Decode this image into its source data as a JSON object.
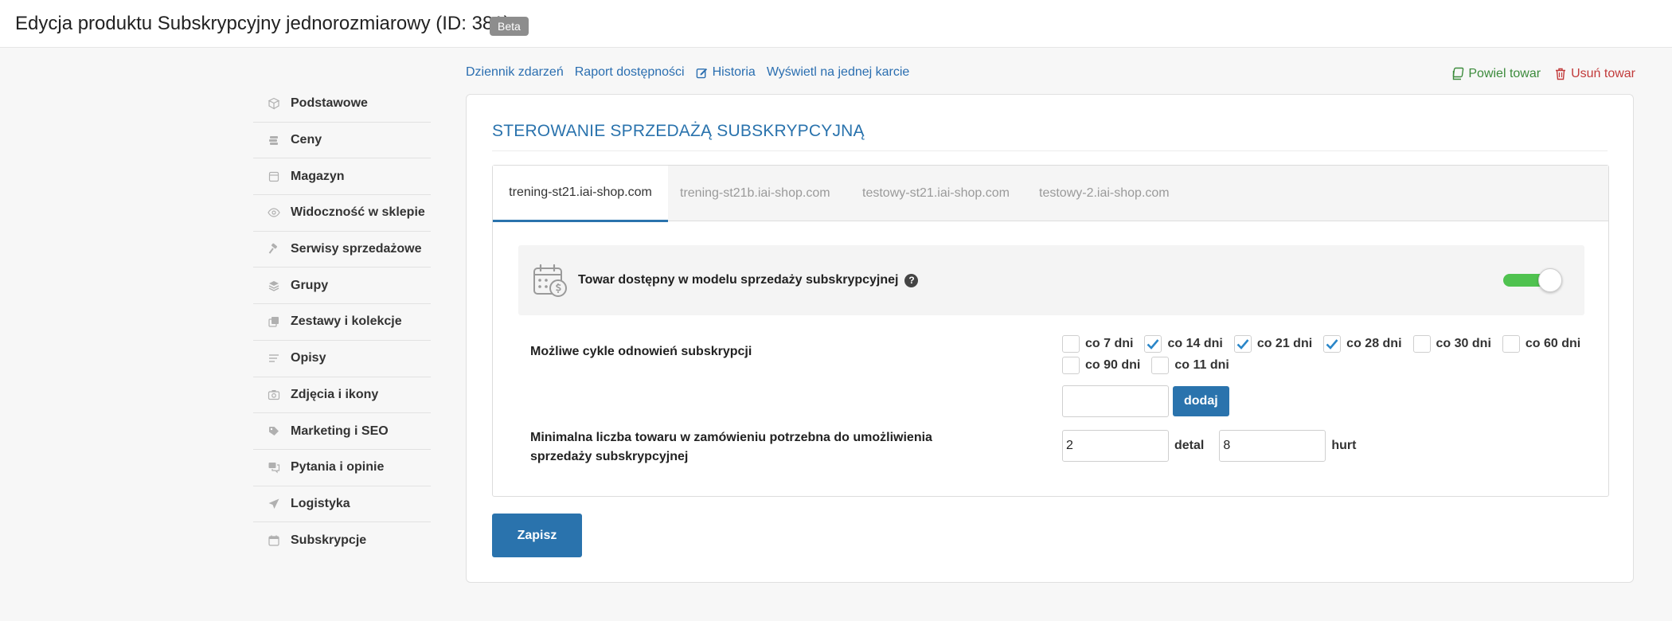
{
  "header": {
    "title": "Edycja produktu Subskrypcyjny jednorozmiarowy (ID: 381)",
    "badge": "Beta"
  },
  "sidebar": {
    "items": [
      {
        "label": "Podstawowe",
        "icon": "box-icon"
      },
      {
        "label": "Ceny",
        "icon": "coins-icon"
      },
      {
        "label": "Magazyn",
        "icon": "warehouse-icon"
      },
      {
        "label": "Widoczność w sklepie",
        "icon": "eye-icon"
      },
      {
        "label": "Serwisy sprzedażowe",
        "icon": "gavel-icon"
      },
      {
        "label": "Grupy",
        "icon": "layers-icon"
      },
      {
        "label": "Zestawy i kolekcje",
        "icon": "collection-icon"
      },
      {
        "label": "Opisy",
        "icon": "text-icon"
      },
      {
        "label": "Zdjęcia i ikony",
        "icon": "camera-icon"
      },
      {
        "label": "Marketing i SEO",
        "icon": "tag-icon"
      },
      {
        "label": "Pytania i opinie",
        "icon": "comments-icon"
      },
      {
        "label": "Logistyka",
        "icon": "send-icon"
      },
      {
        "label": "Subskrypcje",
        "icon": "calendar-icon"
      }
    ]
  },
  "toplinks": {
    "event_log": "Dziennik zdarzeń",
    "availability_report": "Raport dostępności",
    "history": "Historia",
    "single_card": "Wyświetl na jednej karcie"
  },
  "actions": {
    "duplicate": "Powiel towar",
    "delete": "Usuń towar"
  },
  "panel": {
    "title": "STEROWANIE SPRZEDAŻĄ SUBSKRYPCYJNĄ",
    "tabs": [
      {
        "label": "trening-st21.iai-shop.com",
        "active": true
      },
      {
        "label": "trening-st21b.iai-shop.com",
        "active": false
      },
      {
        "label": "testowy-st21.iai-shop.com",
        "active": false
      },
      {
        "label": "testowy-2.iai-shop.com",
        "active": false
      }
    ],
    "availability_label": "Towar dostępny w modelu sprzedaży subskrypcyjnej",
    "availability_enabled": true,
    "cycles_label": "Możliwe cykle odnowień subskrypcji",
    "cycles": [
      {
        "label": "co 7 dni",
        "checked": false
      },
      {
        "label": "co 14 dni",
        "checked": true
      },
      {
        "label": "co 21 dni",
        "checked": true
      },
      {
        "label": "co 28 dni",
        "checked": true
      },
      {
        "label": "co 30 dni",
        "checked": false
      },
      {
        "label": "co 60 dni",
        "checked": false
      },
      {
        "label": "co 90 dni",
        "checked": false
      },
      {
        "label": "co 11 dni",
        "checked": false
      }
    ],
    "new_cycle_value": "",
    "add_button": "dodaj",
    "min_qty_label": "Minimalna liczba towaru w zamówieniu potrzebna do umożliwienia sprzedaży subskrypcyjnej",
    "retail_value": "2",
    "retail_unit": "detal",
    "wholesale_value": "8",
    "wholesale_unit": "hurt",
    "save_button": "Zapisz"
  },
  "colors": {
    "accent": "#2a73ad",
    "link": "#2a6eb0",
    "toggle_on": "#4fc24f",
    "duplicate": "#3c8b3c",
    "delete": "#c23b3b"
  }
}
